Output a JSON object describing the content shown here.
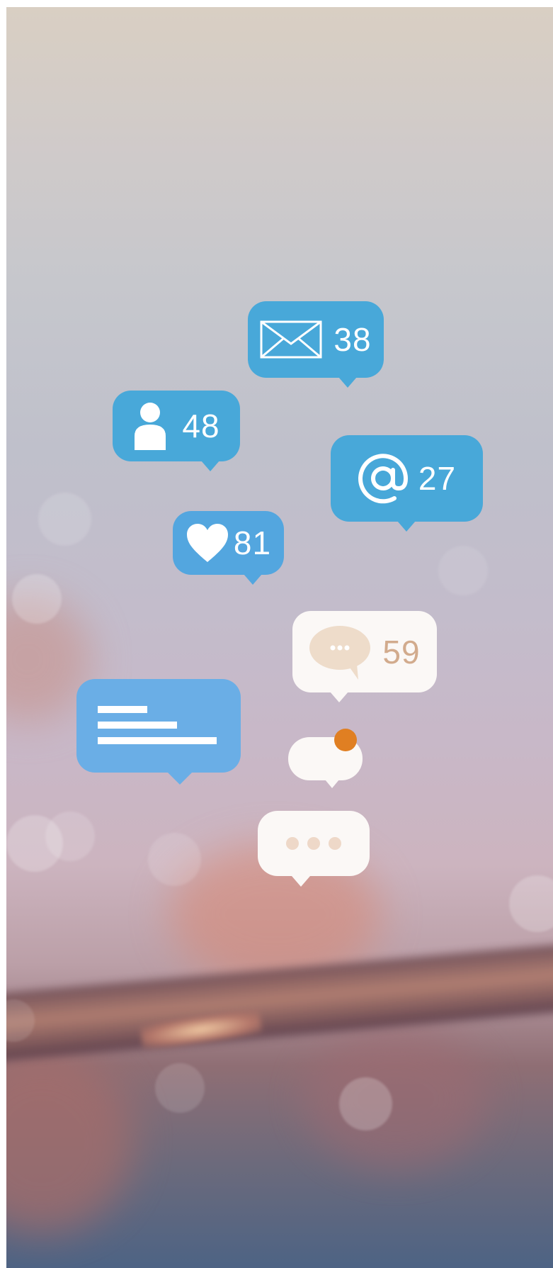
{
  "notifications": {
    "mail": {
      "icon": "envelope-icon",
      "count": "38"
    },
    "followers": {
      "icon": "person-icon",
      "count": "48"
    },
    "mentions": {
      "icon": "at-sign-icon",
      "count": "27"
    },
    "likes": {
      "icon": "heart-icon",
      "count": "81"
    },
    "comments": {
      "icon": "comment-icon",
      "count": "59"
    },
    "post": {
      "icon": "text-lines-icon"
    },
    "alert": {
      "icon": "notification-dot-icon"
    },
    "typing": {
      "icon": "ellipsis-icon"
    }
  },
  "colors": {
    "bubble_blue": "#48a8d9",
    "bubble_light_blue": "#6aaee6",
    "bubble_white": "#fbf8f6",
    "accent_orange": "#e07f22",
    "tan": "#d2ab8d"
  }
}
